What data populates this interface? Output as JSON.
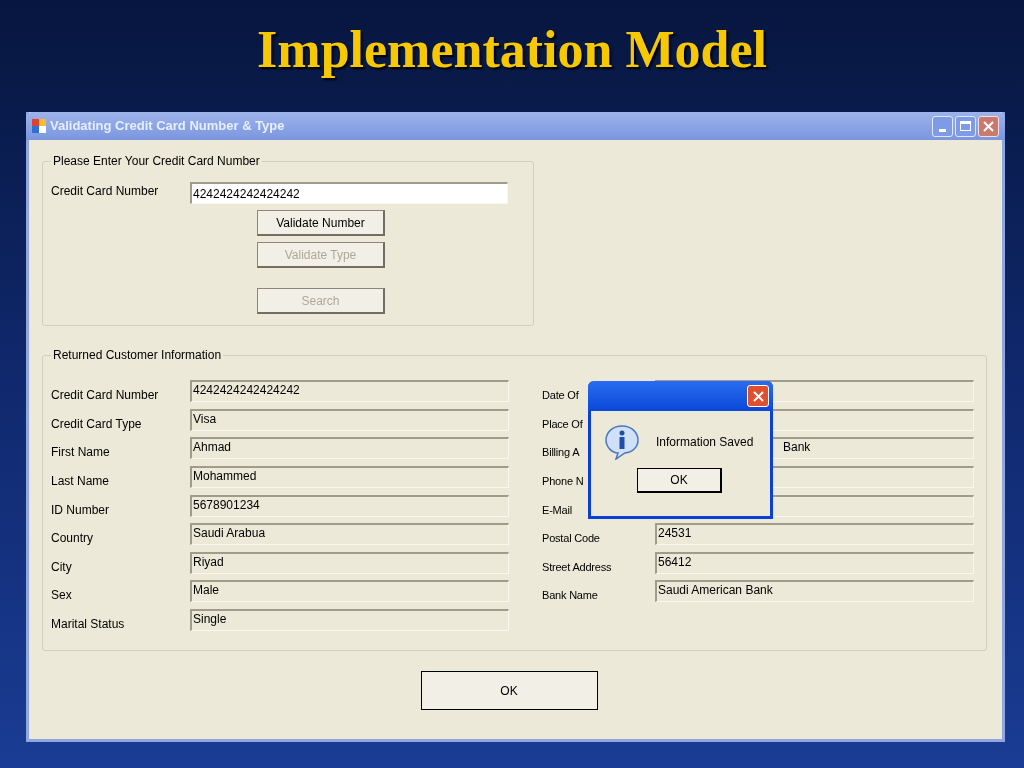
{
  "slide_title": "Implementation Model",
  "window": {
    "title": "Validating Credit Card Number & Type"
  },
  "entry_group": {
    "title": "Please Enter Your Credit Card Number",
    "label": "Credit Card Number",
    "value": "4242424242424242",
    "buttons": [
      {
        "label": "Validate Number",
        "disabled": false
      },
      {
        "label": "Validate Type",
        "disabled": true
      },
      {
        "label": "Search",
        "disabled": true
      }
    ]
  },
  "info_group": {
    "title": "Returned Customer Information",
    "left_fields": [
      {
        "label": "Credit Card Number",
        "value": "4242424242424242"
      },
      {
        "label": "Credit Card Type",
        "value": "Visa"
      },
      {
        "label": "First Name",
        "value": "Ahmad"
      },
      {
        "label": "Last Name",
        "value": "Mohammed"
      },
      {
        "label": "ID Number",
        "value": "5678901234"
      },
      {
        "label": "Country",
        "value": "Saudi Arabua"
      },
      {
        "label": "City",
        "value": "Riyad"
      },
      {
        "label": "Sex",
        "value": "Male"
      },
      {
        "label": "Marital Status",
        "value": "Single"
      }
    ],
    "right_fields": [
      {
        "label": "Date Of"
      },
      {
        "label": "Place Of"
      },
      {
        "label": "Billing A",
        "value": "Bank",
        "covered": true
      },
      {
        "label": "Phone N"
      },
      {
        "label": "E-Mail"
      },
      {
        "label": "Postal Code",
        "value": "24531"
      },
      {
        "label": "Street Address",
        "value": "56412"
      },
      {
        "label": "Bank Name",
        "value": "Saudi American Bank"
      }
    ]
  },
  "dialog": {
    "message": "Information Saved",
    "button": "OK"
  },
  "ok_button": "OK"
}
